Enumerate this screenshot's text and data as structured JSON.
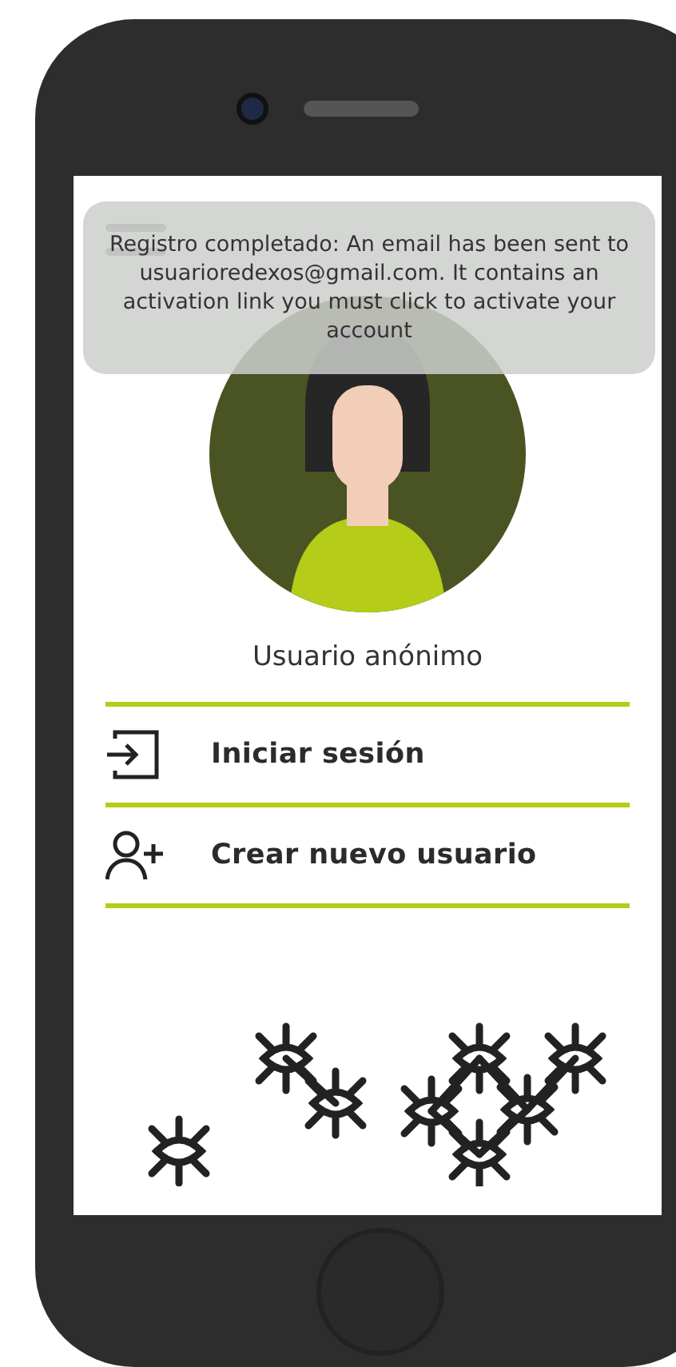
{
  "toast": {
    "message": "Registro completado: An email has been sent to usuarioredexos@gmail.com. It contains an activation link you must click to activate your account"
  },
  "profile": {
    "name": "Usuario anónimo"
  },
  "menu": [
    {
      "kind": "login",
      "label": "Iniciar sesión"
    },
    {
      "kind": "signup",
      "label": "Crear nuevo usuario"
    }
  ]
}
